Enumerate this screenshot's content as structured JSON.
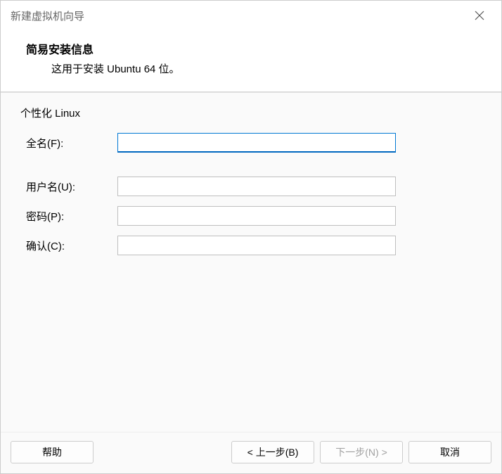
{
  "window": {
    "title": "新建虚拟机向导"
  },
  "header": {
    "title": "简易安装信息",
    "subtitle": "这用于安装 Ubuntu 64 位。"
  },
  "section": {
    "label": "个性化 Linux"
  },
  "form": {
    "fullname": {
      "label": "全名(F):",
      "value": ""
    },
    "username": {
      "label": "用户名(U):",
      "value": ""
    },
    "password": {
      "label": "密码(P):",
      "value": ""
    },
    "confirm": {
      "label": "确认(C):",
      "value": ""
    }
  },
  "footer": {
    "help": "帮助",
    "back": "< 上一步(B)",
    "next": "下一步(N) >",
    "cancel": "取消"
  }
}
